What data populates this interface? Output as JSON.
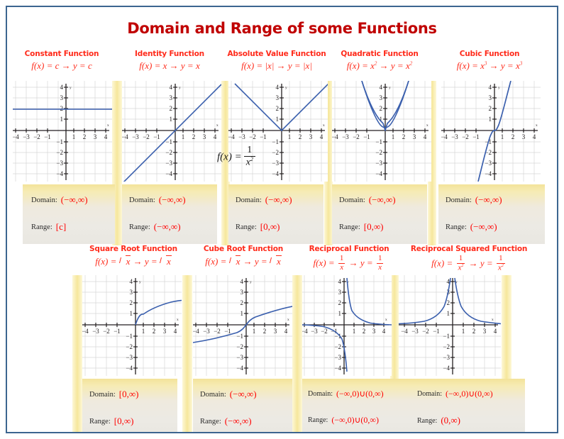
{
  "poster": {
    "title": "Domain and Range of some Functions",
    "title_color": "#c00000",
    "border_color": "#3c6590",
    "accent_red": "#ff2a1a",
    "value_red": "#ff0000",
    "curve_blue": "#3a5fad",
    "panel_yellow": "#f3e39a"
  },
  "labels": {
    "domain": "Domain:",
    "range": "Range:"
  },
  "row1": [
    {
      "id": "constant",
      "title": "Constant Function",
      "formula_plain": "f(x) = c → y = c",
      "domain": "(−∞,∞)",
      "range": "[c]",
      "graph": {
        "type": "line",
        "equation": "y = 2",
        "xlim": [
          -4.6,
          4.6
        ],
        "ylim": [
          -4.4,
          4.4
        ]
      }
    },
    {
      "id": "identity",
      "title": "Identity Function",
      "formula_plain": "f(x) = x → y = x",
      "domain": "(−∞,∞)",
      "range": "(−∞,∞)",
      "graph": {
        "type": "line",
        "equation": "y = x",
        "xlim": [
          -4.6,
          4.6
        ],
        "ylim": [
          -4.4,
          4.4
        ]
      }
    },
    {
      "id": "absolute-value",
      "title": "Absolute Value Function",
      "formula_plain": "f(x) = |x| → y = |x|",
      "domain": "(−∞,∞)",
      "range": "[0,∞)",
      "graph": {
        "type": "line",
        "equation": "y = |x|",
        "xlim": [
          -4.6,
          4.6
        ],
        "ylim": [
          -4.4,
          4.4
        ]
      }
    },
    {
      "id": "quadratic",
      "title": "Quadratic Function",
      "formula_plain": "f(x) = x² → y = x²",
      "domain": "(−∞,∞)",
      "range": "[0,∞)",
      "graph": {
        "type": "curve",
        "equation": "y = x^2",
        "xlim": [
          -4.6,
          4.6
        ],
        "ylim": [
          -4.4,
          4.4
        ]
      }
    },
    {
      "id": "cubic",
      "title": "Cubic Function",
      "formula_plain": "f(x) = x³ → y = x³",
      "domain": "(−∞,∞)",
      "range": "(−∞,∞)",
      "graph": {
        "type": "curve",
        "equation": "y = x^3",
        "xlim": [
          -4.6,
          4.6
        ],
        "ylim": [
          -4.4,
          4.4
        ]
      }
    }
  ],
  "row2": [
    {
      "id": "square-root",
      "title": "Square Root Function",
      "formula_plain": "f(x) = √x → y = √x",
      "domain": "[0,∞)",
      "range": "[0,∞)",
      "graph": {
        "type": "curve",
        "equation": "y = sqrt(x)",
        "xlim": [
          -4.6,
          4.6
        ],
        "ylim": [
          -4.4,
          4.4
        ]
      }
    },
    {
      "id": "cube-root",
      "title": "Cube Root Function",
      "formula_plain": "f(x) = √x → y = √x",
      "domain": "(−∞,∞)",
      "range": "(−∞,∞)",
      "graph": {
        "type": "curve",
        "equation": "y = cbrt(x)",
        "xlim": [
          -4.6,
          4.6
        ],
        "ylim": [
          -4.4,
          4.4
        ]
      }
    },
    {
      "id": "reciprocal",
      "title": "Reciprocal Function",
      "formula_plain": "f(x) = 1/x → y = 1/x",
      "domain": "(−∞,0)∪(0,∞)",
      "range": "(−∞,0)∪(0,∞)",
      "graph": {
        "type": "curve",
        "equation": "y = 1/x",
        "xlim": [
          -4.6,
          4.6
        ],
        "ylim": [
          -4.4,
          4.4
        ]
      }
    },
    {
      "id": "reciprocal-squared",
      "title": "Reciprocal Squared Function",
      "formula_plain": "f(x) = 1/x² → y = 1/x²",
      "domain": "(−∞,0)∪(0,∞)",
      "range": "(0,∞)",
      "graph": {
        "type": "curve",
        "equation": "y = 1/x^2",
        "xlim": [
          -4.6,
          4.6
        ],
        "ylim": [
          -4.4,
          4.4
        ]
      }
    }
  ],
  "overlay_formula": {
    "lhs": "f(x) =",
    "num": "1",
    "den": "x",
    "den_exp": "2"
  },
  "axis": {
    "x_ticks": [
      "−4",
      "−3",
      "−2",
      "−1",
      "1",
      "2",
      "3",
      "4"
    ],
    "y_ticks": [
      "4",
      "3",
      "2",
      "1",
      "−1",
      "−2",
      "−3",
      "−4"
    ],
    "x_label": "x",
    "y_label": "y"
  }
}
